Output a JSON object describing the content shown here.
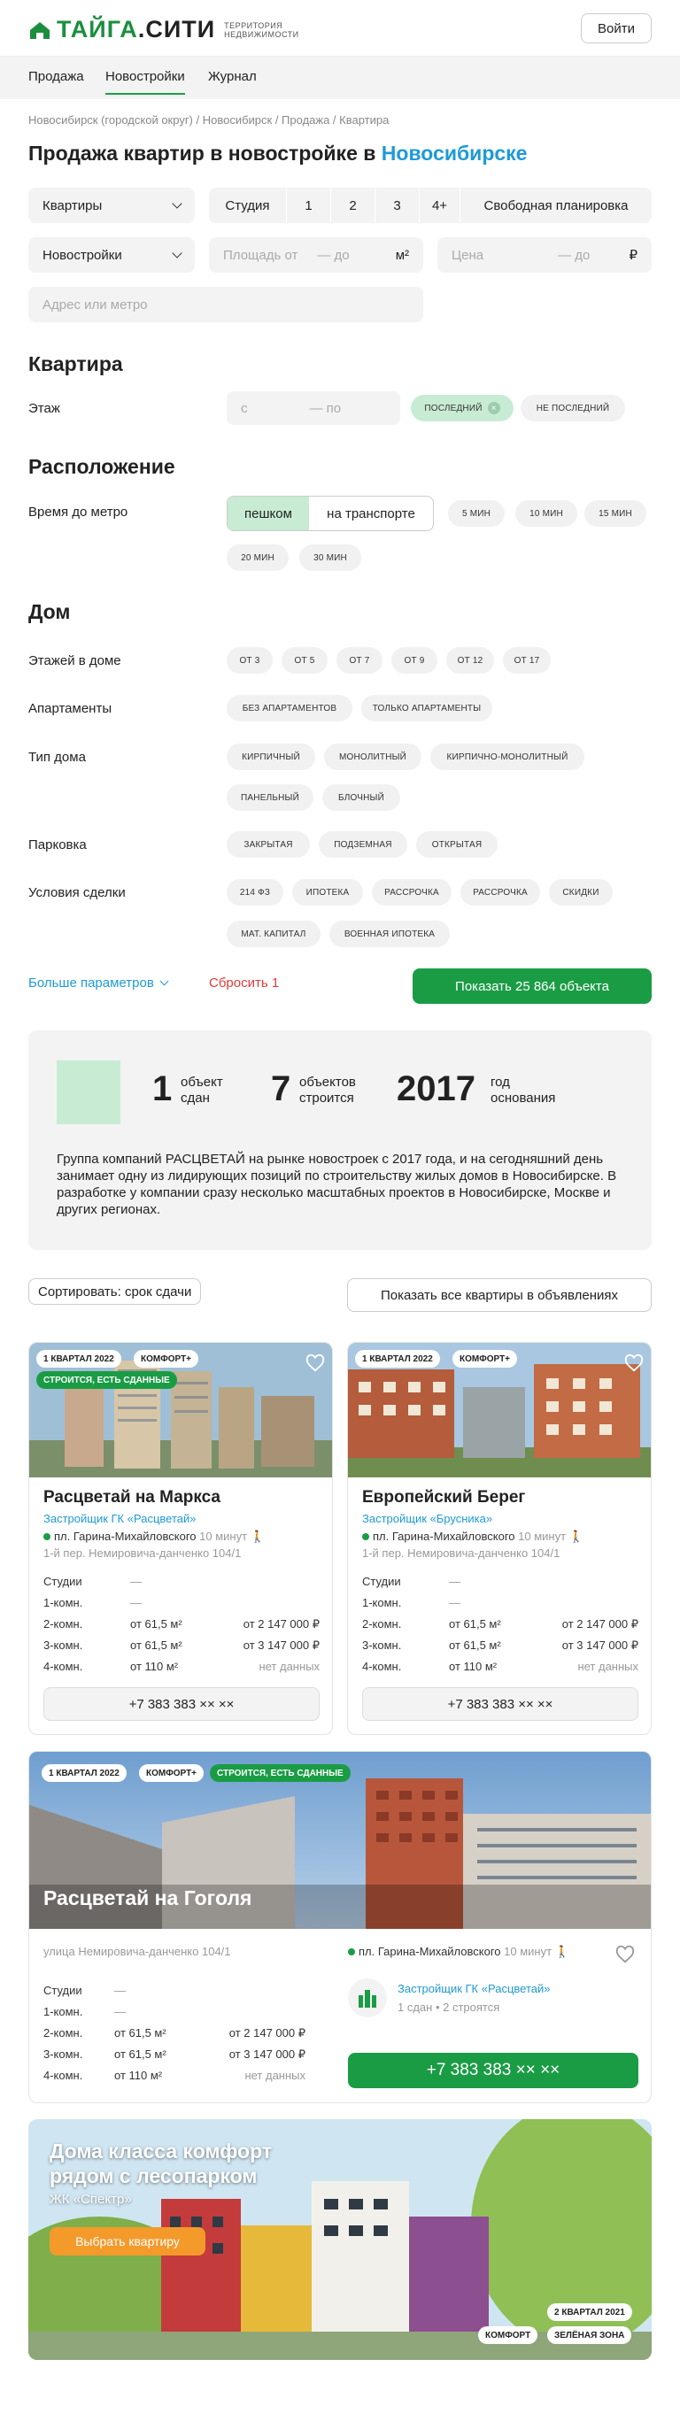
{
  "header": {
    "logo_a": "ТАЙГА",
    "logo_b": ".СИТИ",
    "logo_sub1": "территория",
    "logo_sub2": "недвижимости",
    "login": "Войти"
  },
  "nav": [
    "Продажа",
    "Новостройки",
    "Журнал"
  ],
  "breadcrumb": "Новосибирск (городской округ) / Новосибирск / Продажа / Квартира",
  "title": {
    "text": "Продажа квартир в новостройке в ",
    "city": "Новосибирске"
  },
  "filters": {
    "type": "Квартиры",
    "rooms": [
      "Студия",
      "1",
      "2",
      "3",
      "4+",
      "Свободная планировка"
    ],
    "market": "Новостройки",
    "area_from": "Площадь от",
    "area_to": "— до",
    "area_unit": "м²",
    "price": "Цена",
    "price_to": "— до",
    "price_unit": "₽",
    "address": "Адрес или метро"
  },
  "apartment": {
    "heading": "Квартира",
    "floor_label": "Этаж",
    "floor_from": "с",
    "floor_to": "— по",
    "chips": [
      "последний",
      "не последний"
    ]
  },
  "location": {
    "heading": "Расположение",
    "metro_label": "Время до метро",
    "modes": [
      "пешком",
      "на транспорте"
    ],
    "times": [
      "5 мин",
      "10 мин",
      "15 мин",
      "20 мин",
      "30 мин"
    ]
  },
  "house": {
    "heading": "Дом",
    "floors_label": "Этажей в доме",
    "floors": [
      "от 3",
      "от 5",
      "от 7",
      "от 9",
      "от 12",
      "от 17"
    ],
    "apart_label": "Апартаменты",
    "apart": [
      "без апартаментов",
      "только апартаменты"
    ],
    "type_label": "Тип дома",
    "types": [
      "кирпичный",
      "монолитный",
      "кирпично-монолитный",
      "панельный",
      "блочный"
    ],
    "parking_label": "Парковка",
    "parking": [
      "закрытая",
      "подземная",
      "открытая"
    ],
    "deal_label": "Условия сделки",
    "deals": [
      "214 ФЗ",
      "ипотека",
      "рассрочка",
      "рассрочка",
      "скидки",
      "мат. капитал",
      "военная ипотека"
    ]
  },
  "actions": {
    "more": "Больше параметров",
    "reset": "Сбросить 1",
    "show": "Показать 25 864 объекта"
  },
  "developer": {
    "s1_num": "1",
    "s1_a": "объект",
    "s1_b": "сдан",
    "s2_num": "7",
    "s2_a": "объектов",
    "s2_b": "строится",
    "s3_num": "2017",
    "s3_a": "год",
    "s3_b": "основания",
    "text": "Группа компаний РАСЦВЕТАЙ на рынке новостроек с 2017 года, и на сегодняшний день занимает одну из лидирующих позиций по строительству жилых домов в Новосибирске. В разработке у компании сразу несколько масштабных проектов в Новосибирске, Москве и других регионах."
  },
  "sort": {
    "label": "Сортировать: срок сдачи",
    "all": "Показать все квартиры в объявлениях"
  },
  "cards": [
    {
      "badges": [
        "1 квартал 2022",
        "комфорт+"
      ],
      "badge_green": "строится, есть сданные",
      "name": "Расцветай на Маркса",
      "dev": "Застройщик ГК «Расцветай»",
      "metro": "пл. Гарина-Михайловского",
      "walk": "10 минут",
      "addr": "1-й пер. Немировича-данченко 104/1",
      "rows": [
        [
          "Студии",
          "—",
          ""
        ],
        [
          "1-комн.",
          "—",
          ""
        ],
        [
          "2-комн.",
          "от 61,5 м²",
          "от 2 147 000 ₽"
        ],
        [
          "3-комн.",
          "от 61,5 м²",
          "от 3 147 000 ₽"
        ],
        [
          "4-комн.",
          "от 110 м²",
          "нет данных"
        ]
      ],
      "phone": "+7 383 383 ×× ××"
    },
    {
      "badges": [
        "1 квартал 2022",
        "комфорт+"
      ],
      "name": "Европейский Берег",
      "dev": "Застройщик «Брусника»",
      "metro": "пл. Гарина-Михайловского",
      "walk": "10 минут",
      "addr": "1-й пер. Немировича-данченко 104/1",
      "rows": [
        [
          "Студии",
          "—",
          ""
        ],
        [
          "1-комн.",
          "—",
          ""
        ],
        [
          "2-комн.",
          "от 61,5 м²",
          "от 2 147 000 ₽"
        ],
        [
          "3-комн.",
          "от 61,5 м²",
          "от 3 147 000 ₽"
        ],
        [
          "4-комн.",
          "от 110 м²",
          "нет данных"
        ]
      ],
      "phone": "+7 383 383 ×× ××"
    }
  ],
  "wide": {
    "badges": [
      "1 квартал 2022",
      "комфорт+"
    ],
    "badge_green": "строится, есть сданные",
    "name": "Расцветай на Гоголя",
    "addr": "улица Немировича-данченко 104/1",
    "metro": "пл. Гарина-Михайловского",
    "walk": "10 минут",
    "dev": "Застройщик ГК «Расцветай»",
    "dev_stats": "1 сдан • 2 строятся",
    "rows": [
      [
        "Студии",
        "—",
        ""
      ],
      [
        "1-комн.",
        "—",
        ""
      ],
      [
        "2-комн.",
        "от 61,5 м²",
        "от 2 147 000 ₽"
      ],
      [
        "3-комн.",
        "от 61,5 м²",
        "от 3 147 000 ₽"
      ],
      [
        "4-комн.",
        "от 110 м²",
        "нет данных"
      ]
    ],
    "phone": "+7 383 383 ×× ××"
  },
  "promo": {
    "title1": "Дома класса комфорт",
    "title2": "рядом с лесопарком",
    "sub": "ЖК «Спектр»",
    "button": "Выбрать квартиру",
    "date": "2 квартал 2021",
    "tags": [
      "комфорт",
      "зелёная зона"
    ]
  }
}
